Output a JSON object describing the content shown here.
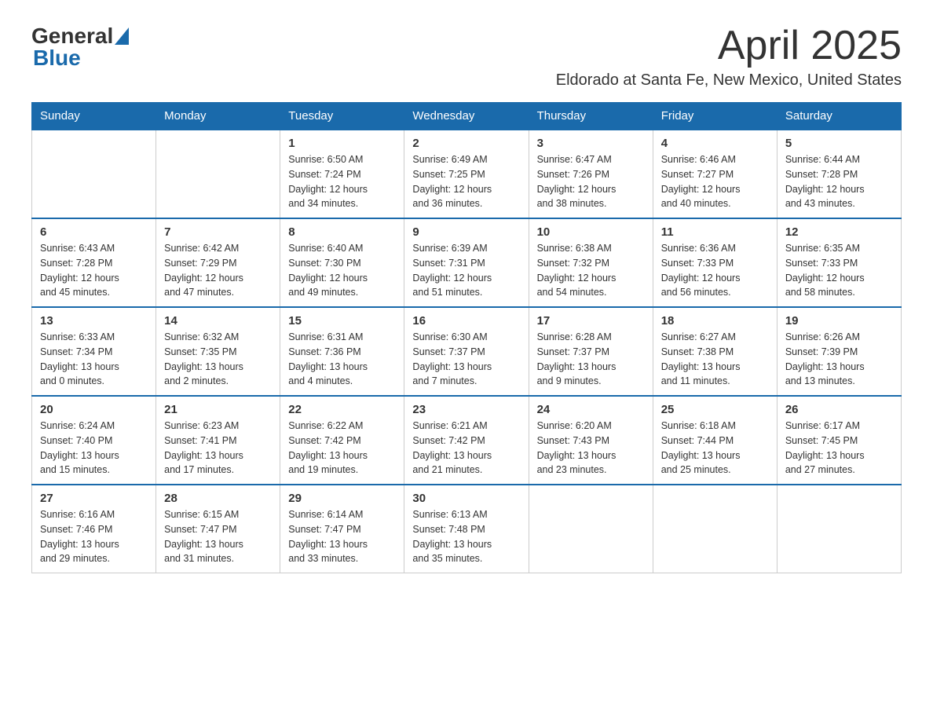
{
  "header": {
    "logo": {
      "general": "General",
      "blue": "Blue",
      "triangle": "▲"
    },
    "month_title": "April 2025",
    "location": "Eldorado at Santa Fe, New Mexico, United States"
  },
  "weekdays": [
    "Sunday",
    "Monday",
    "Tuesday",
    "Wednesday",
    "Thursday",
    "Friday",
    "Saturday"
  ],
  "weeks": [
    {
      "days": [
        {
          "date": "",
          "info": ""
        },
        {
          "date": "",
          "info": ""
        },
        {
          "date": "1",
          "info": "Sunrise: 6:50 AM\nSunset: 7:24 PM\nDaylight: 12 hours\nand 34 minutes."
        },
        {
          "date": "2",
          "info": "Sunrise: 6:49 AM\nSunset: 7:25 PM\nDaylight: 12 hours\nand 36 minutes."
        },
        {
          "date": "3",
          "info": "Sunrise: 6:47 AM\nSunset: 7:26 PM\nDaylight: 12 hours\nand 38 minutes."
        },
        {
          "date": "4",
          "info": "Sunrise: 6:46 AM\nSunset: 7:27 PM\nDaylight: 12 hours\nand 40 minutes."
        },
        {
          "date": "5",
          "info": "Sunrise: 6:44 AM\nSunset: 7:28 PM\nDaylight: 12 hours\nand 43 minutes."
        }
      ]
    },
    {
      "days": [
        {
          "date": "6",
          "info": "Sunrise: 6:43 AM\nSunset: 7:28 PM\nDaylight: 12 hours\nand 45 minutes."
        },
        {
          "date": "7",
          "info": "Sunrise: 6:42 AM\nSunset: 7:29 PM\nDaylight: 12 hours\nand 47 minutes."
        },
        {
          "date": "8",
          "info": "Sunrise: 6:40 AM\nSunset: 7:30 PM\nDaylight: 12 hours\nand 49 minutes."
        },
        {
          "date": "9",
          "info": "Sunrise: 6:39 AM\nSunset: 7:31 PM\nDaylight: 12 hours\nand 51 minutes."
        },
        {
          "date": "10",
          "info": "Sunrise: 6:38 AM\nSunset: 7:32 PM\nDaylight: 12 hours\nand 54 minutes."
        },
        {
          "date": "11",
          "info": "Sunrise: 6:36 AM\nSunset: 7:33 PM\nDaylight: 12 hours\nand 56 minutes."
        },
        {
          "date": "12",
          "info": "Sunrise: 6:35 AM\nSunset: 7:33 PM\nDaylight: 12 hours\nand 58 minutes."
        }
      ]
    },
    {
      "days": [
        {
          "date": "13",
          "info": "Sunrise: 6:33 AM\nSunset: 7:34 PM\nDaylight: 13 hours\nand 0 minutes."
        },
        {
          "date": "14",
          "info": "Sunrise: 6:32 AM\nSunset: 7:35 PM\nDaylight: 13 hours\nand 2 minutes."
        },
        {
          "date": "15",
          "info": "Sunrise: 6:31 AM\nSunset: 7:36 PM\nDaylight: 13 hours\nand 4 minutes."
        },
        {
          "date": "16",
          "info": "Sunrise: 6:30 AM\nSunset: 7:37 PM\nDaylight: 13 hours\nand 7 minutes."
        },
        {
          "date": "17",
          "info": "Sunrise: 6:28 AM\nSunset: 7:37 PM\nDaylight: 13 hours\nand 9 minutes."
        },
        {
          "date": "18",
          "info": "Sunrise: 6:27 AM\nSunset: 7:38 PM\nDaylight: 13 hours\nand 11 minutes."
        },
        {
          "date": "19",
          "info": "Sunrise: 6:26 AM\nSunset: 7:39 PM\nDaylight: 13 hours\nand 13 minutes."
        }
      ]
    },
    {
      "days": [
        {
          "date": "20",
          "info": "Sunrise: 6:24 AM\nSunset: 7:40 PM\nDaylight: 13 hours\nand 15 minutes."
        },
        {
          "date": "21",
          "info": "Sunrise: 6:23 AM\nSunset: 7:41 PM\nDaylight: 13 hours\nand 17 minutes."
        },
        {
          "date": "22",
          "info": "Sunrise: 6:22 AM\nSunset: 7:42 PM\nDaylight: 13 hours\nand 19 minutes."
        },
        {
          "date": "23",
          "info": "Sunrise: 6:21 AM\nSunset: 7:42 PM\nDaylight: 13 hours\nand 21 minutes."
        },
        {
          "date": "24",
          "info": "Sunrise: 6:20 AM\nSunset: 7:43 PM\nDaylight: 13 hours\nand 23 minutes."
        },
        {
          "date": "25",
          "info": "Sunrise: 6:18 AM\nSunset: 7:44 PM\nDaylight: 13 hours\nand 25 minutes."
        },
        {
          "date": "26",
          "info": "Sunrise: 6:17 AM\nSunset: 7:45 PM\nDaylight: 13 hours\nand 27 minutes."
        }
      ]
    },
    {
      "days": [
        {
          "date": "27",
          "info": "Sunrise: 6:16 AM\nSunset: 7:46 PM\nDaylight: 13 hours\nand 29 minutes."
        },
        {
          "date": "28",
          "info": "Sunrise: 6:15 AM\nSunset: 7:47 PM\nDaylight: 13 hours\nand 31 minutes."
        },
        {
          "date": "29",
          "info": "Sunrise: 6:14 AM\nSunset: 7:47 PM\nDaylight: 13 hours\nand 33 minutes."
        },
        {
          "date": "30",
          "info": "Sunrise: 6:13 AM\nSunset: 7:48 PM\nDaylight: 13 hours\nand 35 minutes."
        },
        {
          "date": "",
          "info": ""
        },
        {
          "date": "",
          "info": ""
        },
        {
          "date": "",
          "info": ""
        }
      ]
    }
  ]
}
